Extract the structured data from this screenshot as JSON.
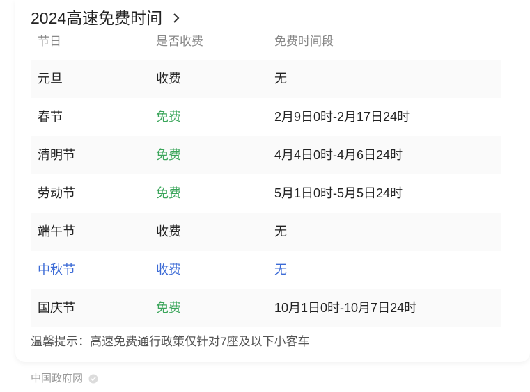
{
  "title": "2024高速免费时间",
  "headers": {
    "holiday": "节日",
    "toll": "是否收费",
    "free_period": "免费时间段"
  },
  "rows": [
    {
      "holiday": "元旦",
      "toll": "收费",
      "period": "无"
    },
    {
      "holiday": "春节",
      "toll": "免费",
      "period": "2月9日0时-2月17日24时"
    },
    {
      "holiday": "清明节",
      "toll": "免费",
      "period": "4月4日0时-4月6日24时"
    },
    {
      "holiday": "劳动节",
      "toll": "免费",
      "period": "5月1日0时-5月5日24时"
    },
    {
      "holiday": "端午节",
      "toll": "收费",
      "period": "无"
    },
    {
      "holiday": "中秋节",
      "toll": "收费",
      "period": "无"
    },
    {
      "holiday": "国庆节",
      "toll": "免费",
      "period": "10月1日0时-10月7日24时"
    }
  ],
  "note": "温馨提示：高速免费通行政策仅针对7座及以下小客车",
  "source": "中国政府网",
  "colors": {
    "free": "#3aa55a",
    "link": "#3c6bd6",
    "header": "#888888"
  },
  "icons": {
    "title_chevron": "chevron-right-icon",
    "source_badge": "verified-badge-icon"
  }
}
